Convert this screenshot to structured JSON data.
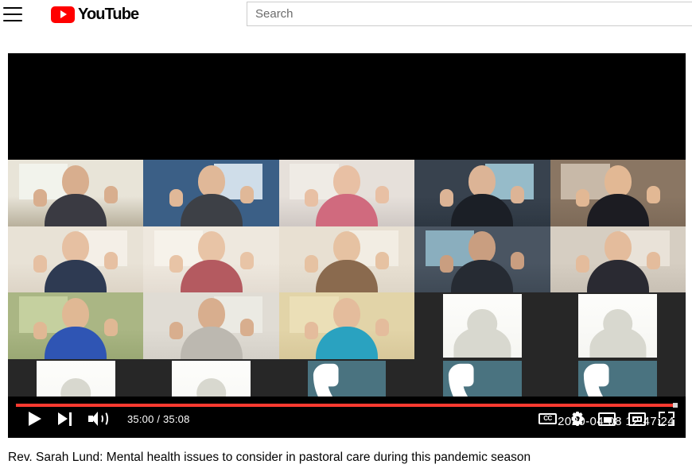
{
  "masthead": {
    "menu_icon": "hamburger-menu-icon",
    "logo_text": "YouTube",
    "logo_icon": "youtube-play-icon",
    "brand_color": "#ff0000"
  },
  "search": {
    "placeholder": "Search",
    "value": ""
  },
  "player": {
    "controls": {
      "play_icon": "play-icon",
      "next_icon": "next-video-icon",
      "volume_icon": "volume-icon",
      "time_display": "35:00 / 35:08",
      "current_time": "35:00",
      "duration": "35:08",
      "progress_percent": 99.6,
      "progress_color": "#ff3a30",
      "captions_label": "CC",
      "captions_icon": "closed-captions-icon",
      "settings_icon": "gear-icon",
      "miniplayer_icon": "miniplayer-icon",
      "theater_icon": "theater-mode-icon",
      "fullscreen_icon": "fullscreen-icon"
    },
    "watermark": "2020-04-08 12:47:24",
    "meeting_grid": {
      "columns": 5,
      "rows": 4,
      "phone_tile_color": "#4a7380",
      "avatar_tile_color": "#d8d8cf",
      "tiles": [
        {
          "kind": "empty"
        },
        {
          "kind": "empty"
        },
        {
          "kind": "empty"
        },
        {
          "kind": "empty"
        },
        {
          "kind": "empty"
        },
        {
          "kind": "video",
          "bg": "#b8b09c",
          "wall": "#e8e4d8",
          "skin": "#d8ae8e",
          "shirt": "#3a3a42",
          "window": "#f2f4ee"
        },
        {
          "kind": "video",
          "bg": "#3b5f86",
          "wall": "#3b5f86",
          "skin": "#e0b898",
          "shirt": "#3d4046",
          "window": "#dce8f2"
        },
        {
          "kind": "video",
          "bg": "#cfc8c4",
          "wall": "#e6e0da",
          "skin": "#e8c0a4",
          "shirt": "#d06a7e",
          "window": "#f0ece6"
        },
        {
          "kind": "video",
          "bg": "#2d3742",
          "wall": "#38424e",
          "skin": "#dcb496",
          "shirt": "#1b1f26",
          "window": "#9ec6d4"
        },
        {
          "kind": "video",
          "bg": "#7d6a58",
          "wall": "#8a7663",
          "skin": "#e2b894",
          "shirt": "#1c1c22",
          "window": "#cdbfae"
        },
        {
          "kind": "video",
          "bg": "#ddd4c6",
          "wall": "#e8e2d6",
          "skin": "#e6c0a2",
          "shirt": "#2e3a52",
          "window": "#f4f0e8"
        },
        {
          "kind": "video",
          "bg": "#e4dcd2",
          "wall": "#eee8de",
          "skin": "#e8c4a6",
          "shirt": "#b45a60",
          "window": "#f6f2ea"
        },
        {
          "kind": "video",
          "bg": "#ded6c8",
          "wall": "#e8e0d2",
          "skin": "#e6c2a2",
          "shirt": "#8a6a4e",
          "window": "#f2eee4"
        },
        {
          "kind": "video",
          "bg": "#3f4a56",
          "wall": "#4a5562",
          "skin": "#c99e80",
          "shirt": "#262b33",
          "window": "#8fb6c6"
        },
        {
          "kind": "video",
          "bg": "#c8c0b4",
          "wall": "#d6cec2",
          "skin": "#e4bc9c",
          "shirt": "#2a2a32",
          "window": "#eae4da"
        },
        {
          "kind": "video",
          "bg": "#9aa874",
          "wall": "#aab684",
          "skin": "#e0b894",
          "shirt": "#2f55b4",
          "window": "#c8d2a2"
        },
        {
          "kind": "video",
          "bg": "#d4d0c8",
          "wall": "#e0dcd4",
          "skin": "#d8ae8e",
          "shirt": "#bcb8b0",
          "window": "#eceae4"
        },
        {
          "kind": "video",
          "bg": "#d8c89a",
          "wall": "#e2d4a8",
          "skin": "#e4bc9c",
          "shirt": "#2aa2c0",
          "window": "#ece0b8"
        },
        {
          "kind": "avatar"
        },
        {
          "kind": "avatar"
        },
        {
          "kind": "avatar"
        },
        {
          "kind": "avatar"
        },
        {
          "kind": "phone"
        },
        {
          "kind": "phone"
        },
        {
          "kind": "phone"
        }
      ]
    }
  },
  "video_title": "Rev. Sarah Lund: Mental health issues to consider in pastoral care during this pandemic season"
}
